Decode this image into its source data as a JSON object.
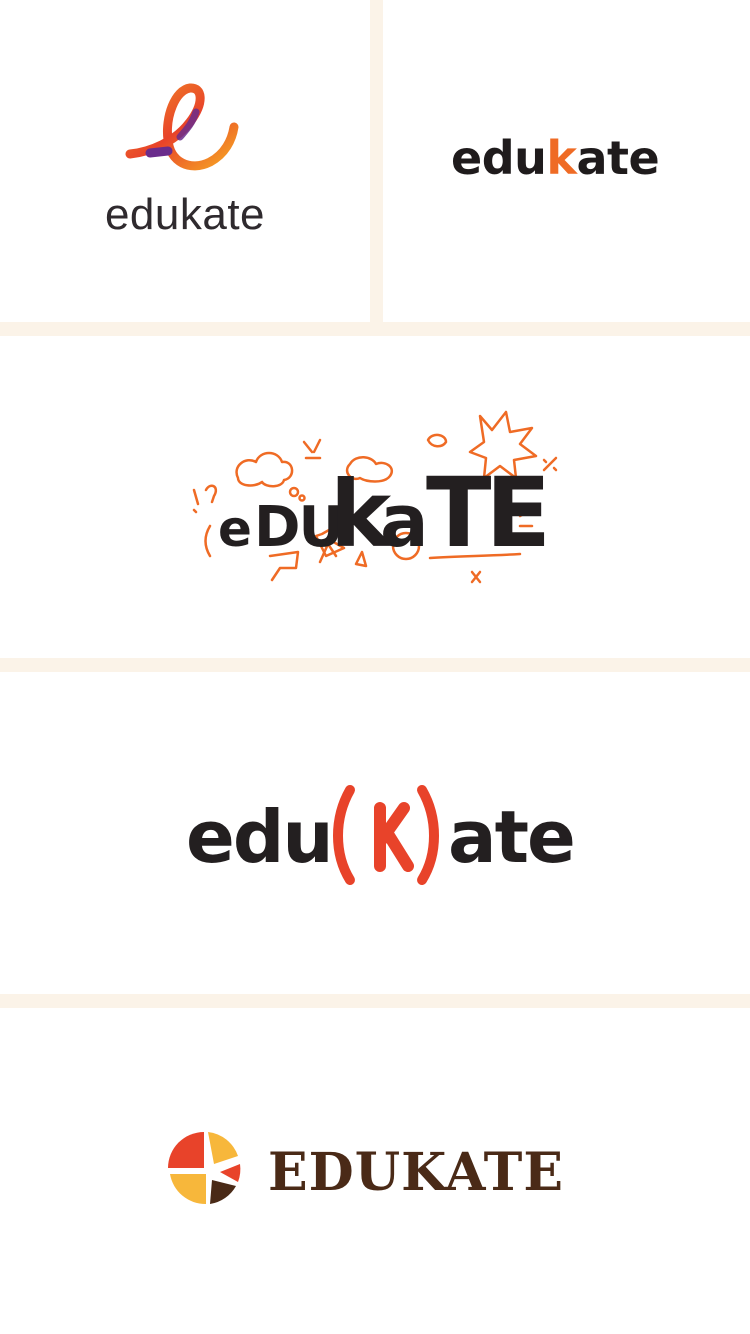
{
  "colors": {
    "background": "#fbf3e8",
    "card": "#ffffff",
    "dark_text": "#231f20",
    "orange": "#ef6b25",
    "red": "#e8432a",
    "yellow": "#f7b73b",
    "brown": "#4a2a17",
    "purple": "#6a2c8c"
  },
  "logos": [
    {
      "id": "logo-1",
      "text": "edukate",
      "icon": "ribbon-e-icon"
    },
    {
      "id": "logo-2",
      "text_before": "edu",
      "text_accent": "k",
      "text_after": "ate"
    },
    {
      "id": "logo-3",
      "text": "eDUkaTE",
      "icon": "doodle-icons"
    },
    {
      "id": "logo-4",
      "text_before": "edu",
      "text_accent": "(K)",
      "text_after": "ate"
    },
    {
      "id": "logo-5",
      "text": "EDUKATE",
      "icon": "pie-k-icon"
    }
  ]
}
